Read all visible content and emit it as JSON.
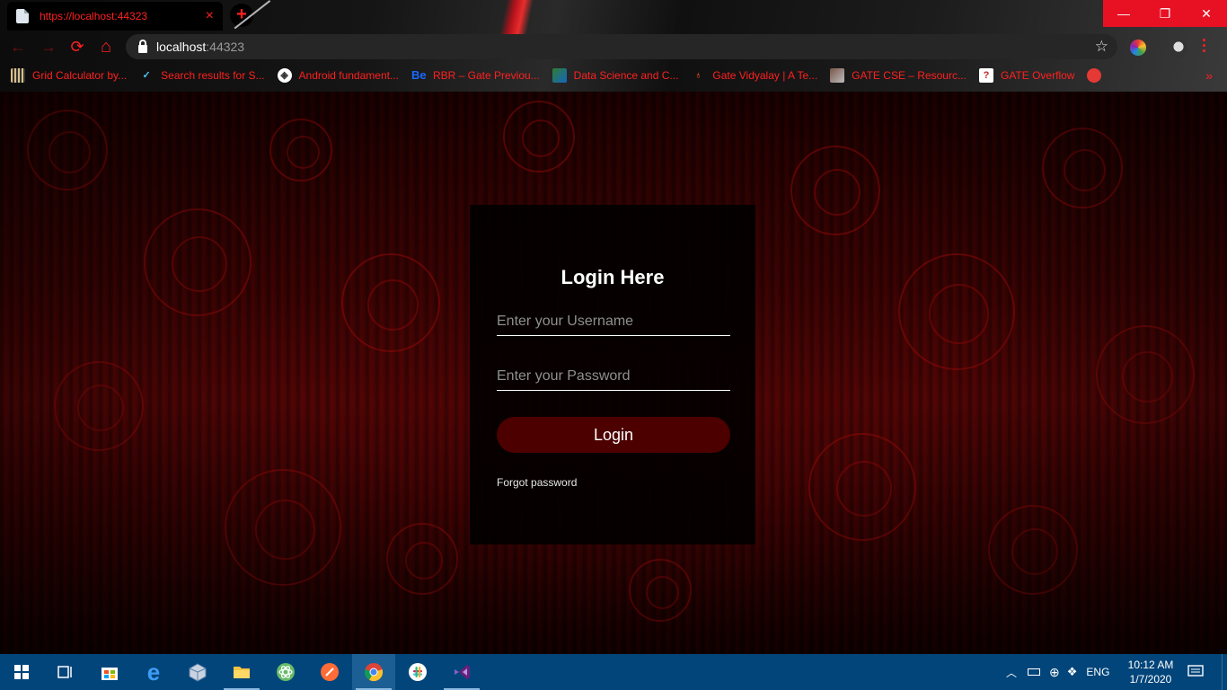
{
  "browser": {
    "tab": {
      "title": "https://localhost:44323",
      "close_icon": "×"
    },
    "new_tab_icon": "+",
    "window_controls": {
      "minimize": "—",
      "restore": "❐",
      "close": "✕"
    },
    "nav": {
      "back": "←",
      "forward": "→",
      "reload": "⟳",
      "home": "⌂"
    },
    "address": {
      "host": "localhost",
      "port": ":44323"
    },
    "bookmark_star": "☆",
    "bookmarks": [
      {
        "label": "Grid Calculator by...",
        "icon": "grid-icon"
      },
      {
        "label": "Search results for S...",
        "icon": "check-icon"
      },
      {
        "label": "Android fundament...",
        "icon": "android-icon"
      },
      {
        "label": "RBR – Gate Previou...",
        "icon": "behance-icon"
      },
      {
        "label": "Data Science and C...",
        "icon": "data-icon"
      },
      {
        "label": "Gate Vidyalay | A Te...",
        "icon": "pin-icon"
      },
      {
        "label": "GATE CSE – Resourc...",
        "icon": "photo-icon"
      },
      {
        "label": "GATE Overflow",
        "icon": "question-icon"
      }
    ],
    "bookmarks_more": "»"
  },
  "login": {
    "title": "Login Here",
    "username_placeholder": "Enter your Username",
    "username_value": "",
    "password_placeholder": "Enter your Password",
    "password_value": "",
    "button_label": "Login",
    "forgot_label": "Forgot password"
  },
  "taskbar": {
    "language": "ENG",
    "time": "10:12 AM",
    "date": "1/7/2020"
  },
  "colors": {
    "accent_red": "#ff2020",
    "card_bg": "#000000",
    "button_bg": "#4d0000",
    "taskbar_bg": "#02457a"
  }
}
